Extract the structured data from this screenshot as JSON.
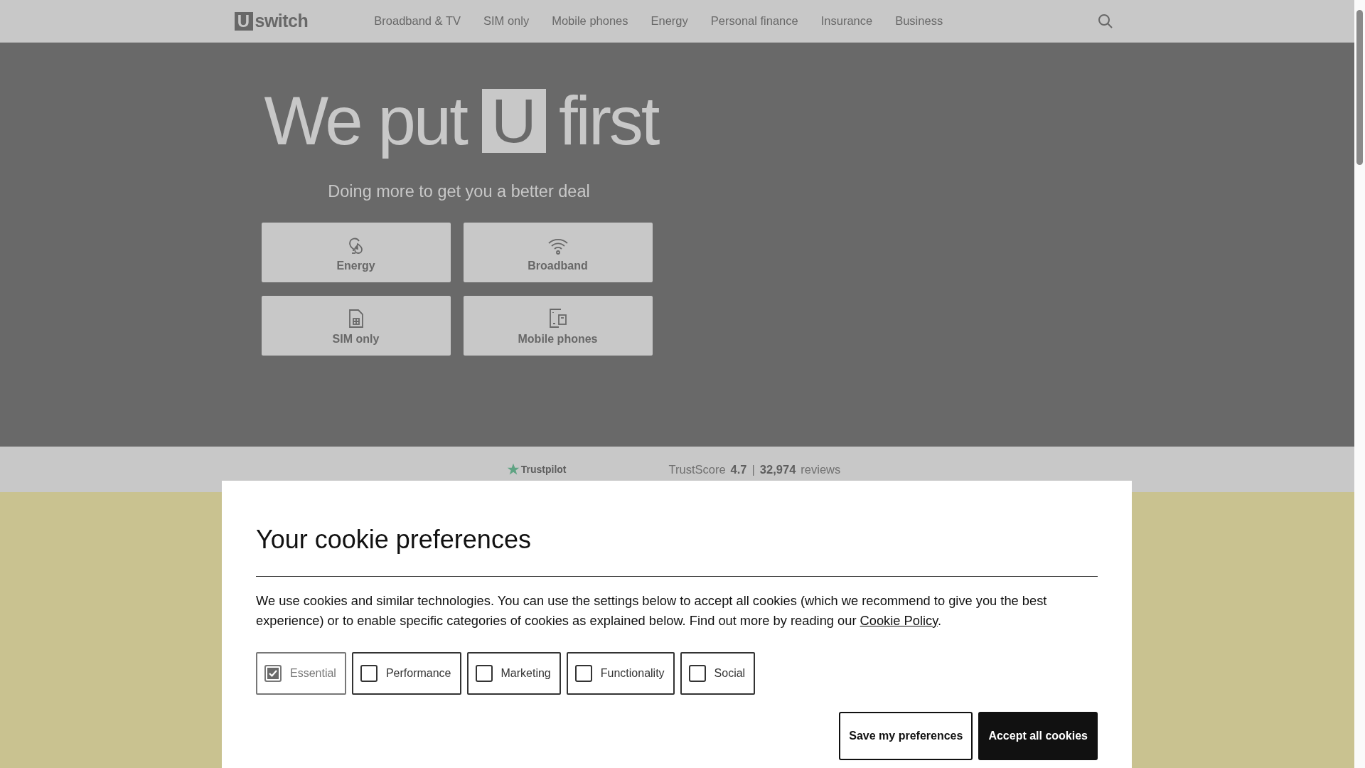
{
  "header": {
    "logo": {
      "mark": "U",
      "text": "switch"
    },
    "nav": [
      "Broadband & TV",
      "SIM only",
      "Mobile phones",
      "Energy",
      "Personal finance",
      "Insurance",
      "Business"
    ]
  },
  "hero": {
    "title": {
      "before": "We put",
      "highlight": "U",
      "after": "first"
    },
    "subtitle": "Doing more to get you a better deal",
    "tiles": [
      {
        "label": "Energy",
        "kind": "energy"
      },
      {
        "label": "Broadband",
        "kind": "broadband"
      },
      {
        "label": "SIM only",
        "kind": "sim"
      },
      {
        "label": "Mobile phones",
        "kind": "mobile"
      }
    ]
  },
  "trust_bar": {
    "brand": "Trustpilot",
    "score_label": "TrustScore",
    "score": "4.7",
    "separator": "|",
    "count": "32,974",
    "count_label": "reviews"
  },
  "cookie_dialog": {
    "title": "Your cookie preferences",
    "text": "We use cookies and similar technologies. You can use the settings below to accept all cookies (which we recommend to give you the best experience) or to enable specific categories of cookies as explained below. Find out more by reading our ",
    "link": "Cookie Policy",
    "text_end": ".",
    "categories": [
      {
        "label": "Essential",
        "checked": true,
        "disabled": true
      },
      {
        "label": "Performance",
        "checked": false,
        "disabled": false
      },
      {
        "label": "Marketing",
        "checked": false,
        "disabled": false
      },
      {
        "label": "Functionality",
        "checked": false,
        "disabled": false
      },
      {
        "label": "Social",
        "checked": false,
        "disabled": false
      }
    ],
    "buttons": [
      {
        "label": "Save my preferences",
        "kind": "secondary"
      },
      {
        "label": "Accept all cookies",
        "kind": "primary"
      }
    ]
  }
}
